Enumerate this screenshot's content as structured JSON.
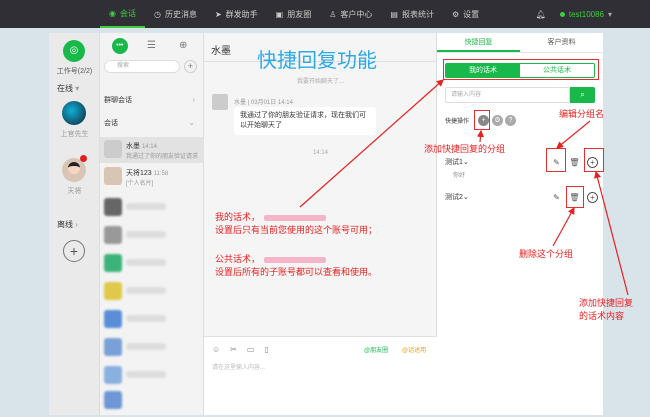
{
  "topnav": {
    "items": [
      {
        "label": "会话",
        "icon": "chat-icon",
        "active": true
      },
      {
        "label": "历史消息",
        "icon": "clock-icon"
      },
      {
        "label": "群发助手",
        "icon": "send-icon"
      },
      {
        "label": "朋友圈",
        "icon": "image-icon"
      },
      {
        "label": "客户中心",
        "icon": "person-icon"
      },
      {
        "label": "报表统计",
        "icon": "chart-icon"
      },
      {
        "label": "设置",
        "icon": "gear-icon"
      }
    ],
    "user": "test10086",
    "accent": "#3fce3f"
  },
  "accounts": {
    "workbench_label": "工作号(2/2)",
    "online_label": "在线",
    "account1_label": "上官先生",
    "account2_label": "天将",
    "offline_label": "离线"
  },
  "contacts": {
    "search_placeholder": "搜索",
    "group_section": "群聊会话",
    "session_section": "会话",
    "items": [
      {
        "name": "水墨",
        "time": "14:14",
        "preview": "我通过了你的朋友验证请求"
      },
      {
        "name": "天将123",
        "time": "11:58",
        "preview": "[个人名片]"
      }
    ]
  },
  "chat": {
    "title": "水墨",
    "system_message": "我要开始聊天了...",
    "sender_meta": "水墨 | 03月01日 14:14",
    "message": "我通过了你的朋友验证请求，现在我们可以开始聊天了",
    "time": "14:14",
    "send_moments": "@朋友圈",
    "send_reply": "@话述用",
    "input_placeholder": "请在这里输入内容..."
  },
  "right_panel": {
    "tabs": [
      "快捷回复",
      "客户资料"
    ],
    "seg_my": "我的话术",
    "seg_public": "公共话术",
    "search_placeholder": "请输入内容",
    "quick_op_label": "快捷操作",
    "groups": [
      {
        "name": "测试1",
        "sub": "你好"
      },
      {
        "name": "测试2",
        "sub": ""
      }
    ],
    "brand_color": "#18b94a"
  },
  "annotations": {
    "title": "快捷回复功能",
    "add_group": "添加快捷回复的分组",
    "edit_group": "编辑分组名",
    "delete_group": "删除这个分组",
    "add_content_line1": "添加快捷回复",
    "add_content_line2": "的话术内容",
    "my_line1": "我的话术，",
    "my_line2": "设置后只有当前您使用的这个账号可用；",
    "public_line1": "公共话术，",
    "public_line2": "设置后所有的子账号都可以查看和使用。",
    "note_color": "#e82020"
  }
}
